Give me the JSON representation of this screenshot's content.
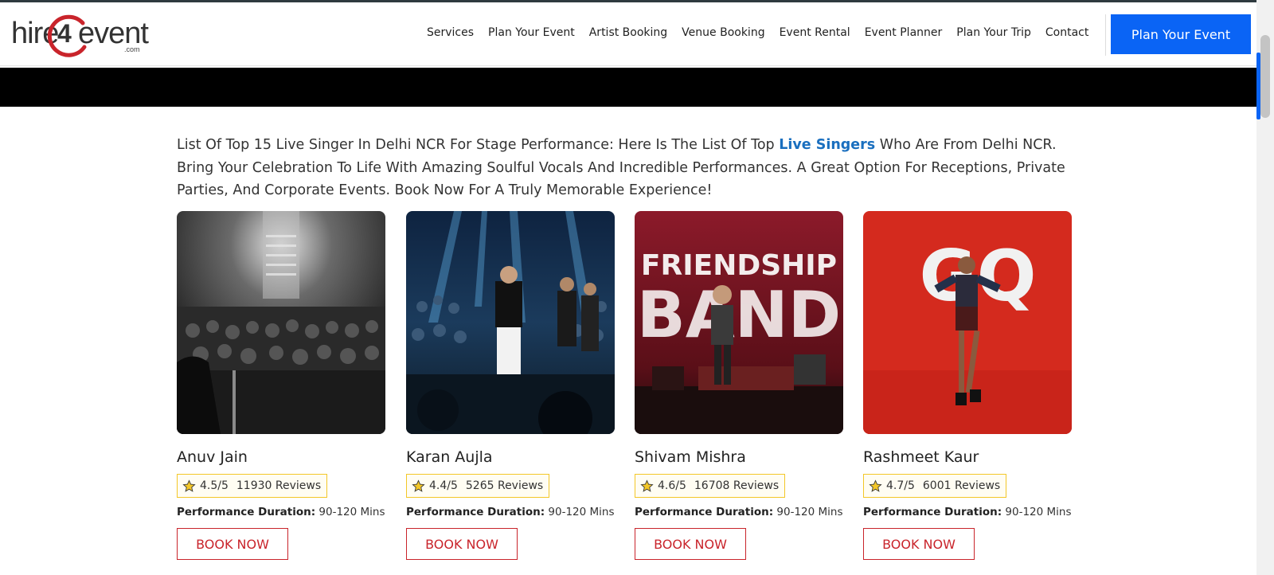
{
  "logo": {
    "left": "hire",
    "num": "4",
    "right": "event",
    "suffix": ".com",
    "accent": "#c9242b"
  },
  "nav": {
    "items": [
      "Services",
      "Plan Your Event",
      "Artist Booking",
      "Venue Booking",
      "Event Rental",
      "Event Planner",
      "Plan Your Trip",
      "Contact"
    ],
    "cta": "Plan Your Event"
  },
  "intro": {
    "before": "List Of Top 15 Live Singer In Delhi NCR For Stage Performance: Here Is The List Of Top ",
    "link": "Live Singers",
    "after": " Who Are From Delhi NCR. Bring Your Celebration To Life With Amazing Soulful Vocals And Incredible Performances. A Great Option For Receptions, Private Parties, And Corporate Events.  Book Now For A Truly Memorable Experience!"
  },
  "cards": [
    {
      "name": "Anuv Jain",
      "rating": "4.5/5",
      "reviews": "11930 Reviews",
      "duration_label": "Performance Duration:",
      "duration": "90-120 Mins",
      "cta": "BOOK NOW"
    },
    {
      "name": "Karan Aujla",
      "rating": "4.4/5",
      "reviews": "5265 Reviews",
      "duration_label": "Performance Duration:",
      "duration": "90-120 Mins",
      "cta": "BOOK NOW"
    },
    {
      "name": "Shivam Mishra",
      "rating": "4.6/5",
      "reviews": "16708 Reviews",
      "duration_label": "Performance Duration:",
      "duration": "90-120 Mins",
      "cta": "BOOK NOW"
    },
    {
      "name": "Rashmeet Kaur",
      "rating": "4.7/5",
      "reviews": "6001 Reviews",
      "duration_label": "Performance Duration:",
      "duration": "90-120 Mins",
      "cta": "BOOK NOW"
    }
  ],
  "photo_text": {
    "band_line1": "FRIENDSHIP",
    "band_line2": "BAND",
    "magazine": "GQ"
  },
  "colors": {
    "cta_blue": "#0a64f5",
    "book_red": "#c9242b",
    "star_yellow": "#f3c728",
    "link_blue": "#1a6fbf"
  }
}
